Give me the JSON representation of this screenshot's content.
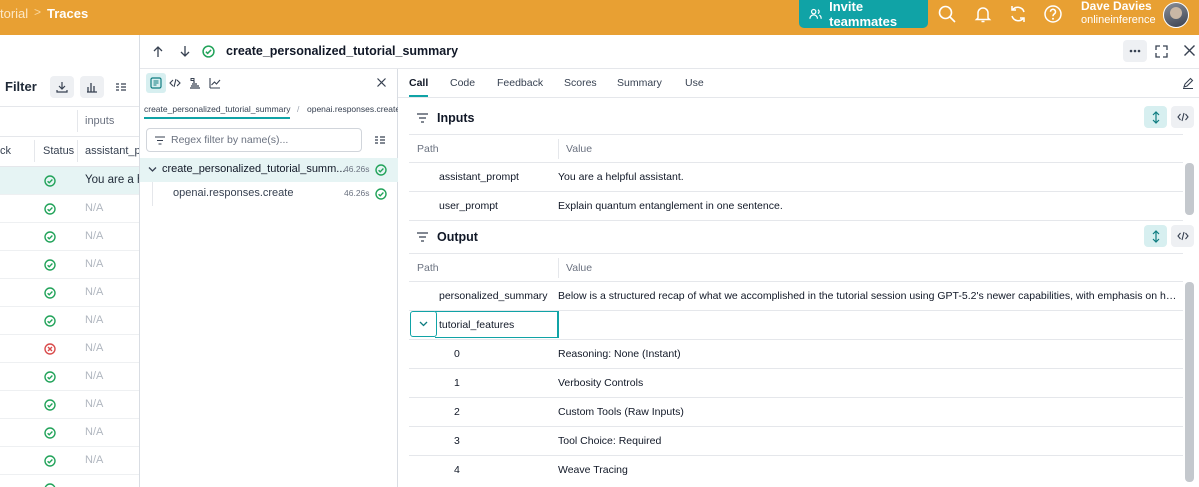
{
  "topbar": {
    "prev_crumb": "torial",
    "separator": ">",
    "current_crumb": "Traces",
    "invite_label": "Invite teammates",
    "icons": [
      "search-icon",
      "bell-icon",
      "refresh-icon",
      "help-icon"
    ],
    "user": {
      "name": "Dave Davies",
      "org": "onlineinference"
    },
    "colors": {
      "bar": "#e8a033",
      "invite": "#10a3a6"
    }
  },
  "left_panel": {
    "filter_label": "Filter",
    "columns": {
      "group_label": "inputs",
      "check_partial": "ck",
      "status": "Status",
      "assistant_prompt": "assistant_pr"
    },
    "rows": [
      {
        "status": "success",
        "text": "You are a he",
        "selected": true
      },
      {
        "status": "success",
        "text": "N/A"
      },
      {
        "status": "success",
        "text": "N/A"
      },
      {
        "status": "success",
        "text": "N/A"
      },
      {
        "status": "success",
        "text": "N/A"
      },
      {
        "status": "success",
        "text": "N/A"
      },
      {
        "status": "error",
        "text": "N/A"
      },
      {
        "status": "success",
        "text": "N/A"
      },
      {
        "status": "success",
        "text": "N/A"
      },
      {
        "status": "success",
        "text": "N/A"
      },
      {
        "status": "success",
        "text": "N/A"
      },
      {
        "status": "success",
        "text": ""
      }
    ]
  },
  "header": {
    "title": "create_personalized_tutorial_summary"
  },
  "middle_panel": {
    "breadcrumbs": [
      "create_personalized_tutorial_summary",
      "openai.responses.create"
    ],
    "breadcrumb_sep": "/",
    "search_placeholder": "Regex filter by name(s)...",
    "tree": [
      {
        "name": "create_personalized_tutorial_summ...",
        "duration": "46.26s",
        "status": "success",
        "expanded": true
      },
      {
        "name": "openai.responses.create",
        "duration": "46.26s",
        "status": "success"
      }
    ]
  },
  "detail": {
    "tabs": [
      "Call",
      "Code",
      "Feedback",
      "Scores",
      "Summary",
      "Use"
    ],
    "active_tab": "Call",
    "inputs": {
      "title": "Inputs",
      "col_path": "Path",
      "col_value": "Value",
      "rows": [
        {
          "key": "assistant_prompt",
          "value": "You are a helpful assistant."
        },
        {
          "key": "user_prompt",
          "value": "Explain quantum entanglement in one sentence."
        }
      ]
    },
    "output": {
      "title": "Output",
      "col_path": "Path",
      "col_value": "Value",
      "summary_key": "personalized_summary",
      "summary_value": "Below is a structured recap of what we accomplished in the tutorial session using GPT-5.2's newer capabilities, with emphasis on how each...",
      "features_key": "tutorial_features",
      "features": [
        {
          "index": "0",
          "value": "Reasoning: None (Instant)"
        },
        {
          "index": "1",
          "value": "Verbosity Controls"
        },
        {
          "index": "2",
          "value": "Custom Tools (Raw Inputs)"
        },
        {
          "index": "3",
          "value": "Tool Choice: Required"
        },
        {
          "index": "4",
          "value": "Weave Tracing"
        }
      ]
    }
  }
}
